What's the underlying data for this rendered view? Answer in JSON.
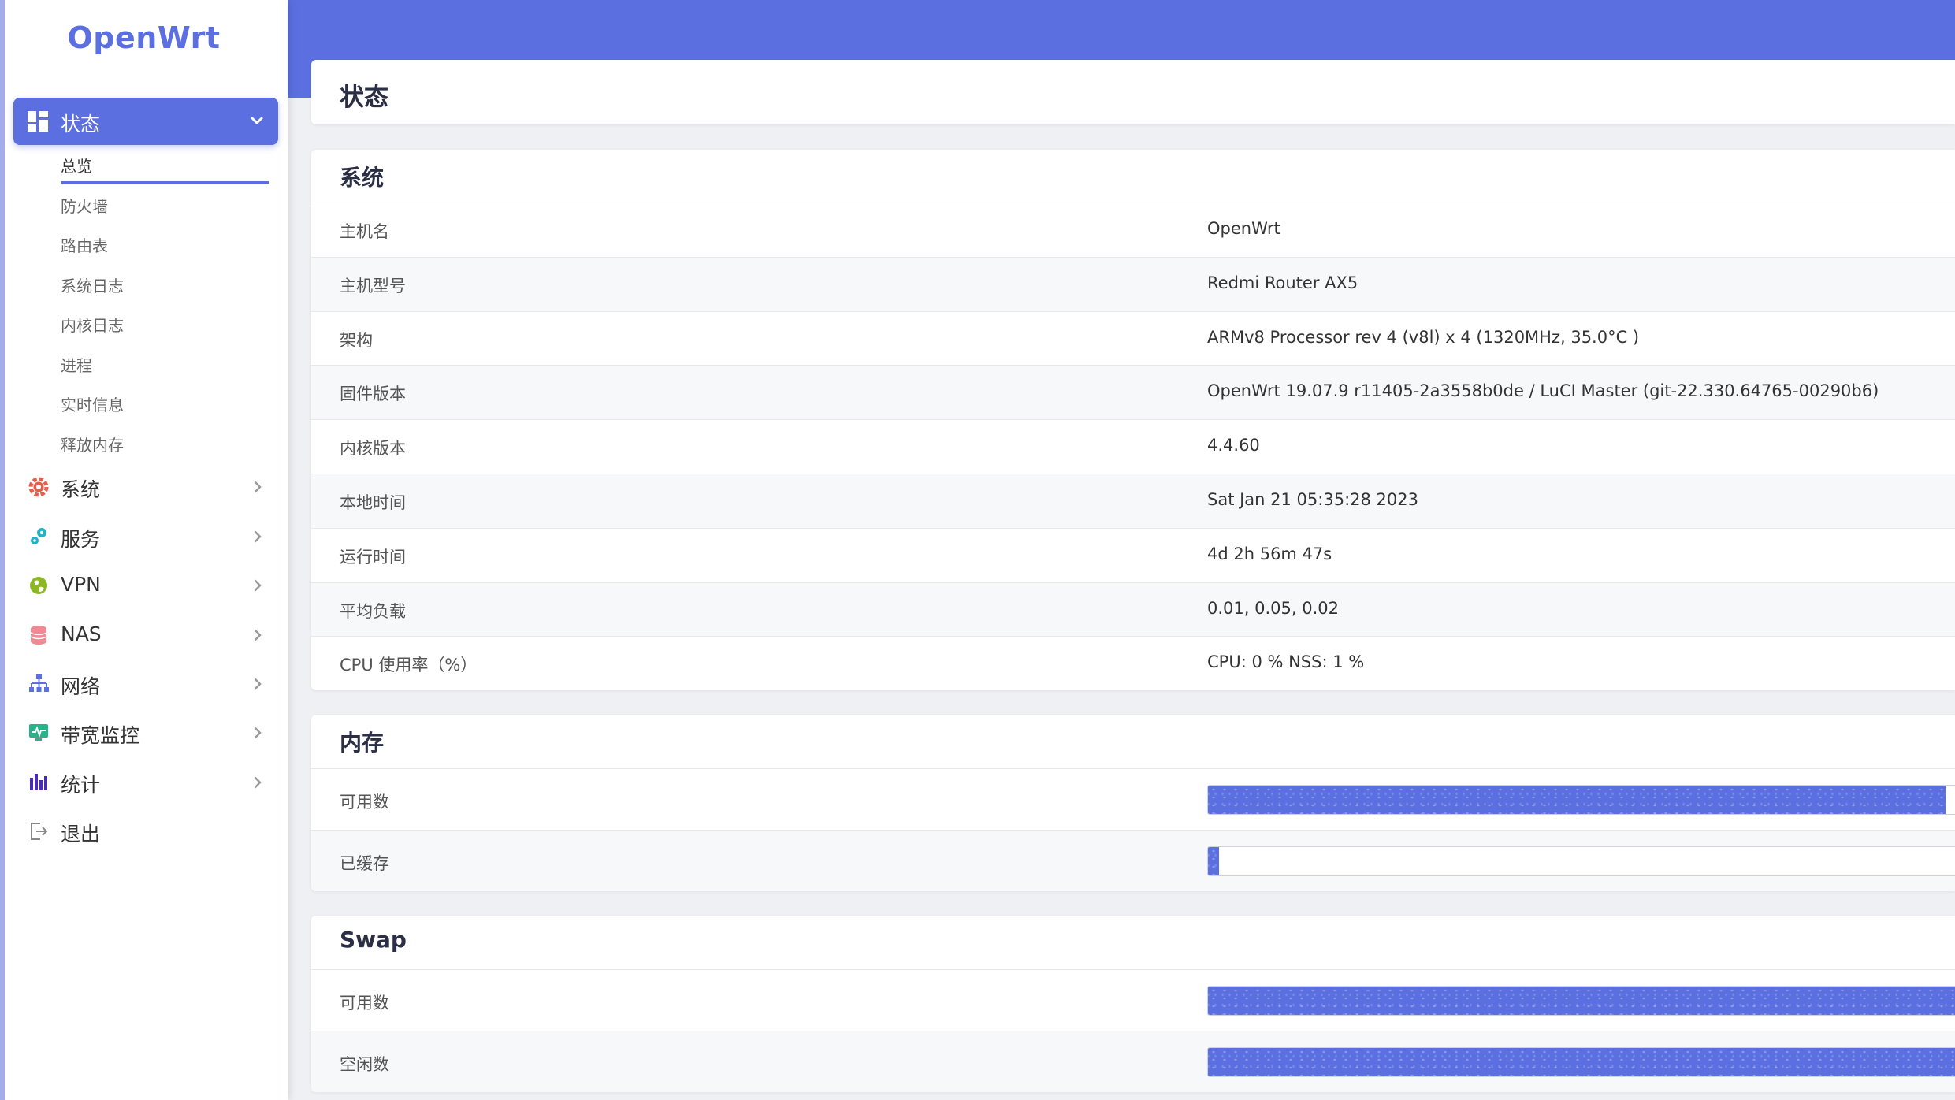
{
  "app": {
    "logo": "OpenWrt"
  },
  "sidebar": {
    "active": {
      "label": "状态"
    },
    "subitems": [
      "总览",
      "防火墙",
      "路由表",
      "系统日志",
      "内核日志",
      "进程",
      "实时信息",
      "释放内存"
    ],
    "items": [
      {
        "label": "系统",
        "icon": "gear-icon"
      },
      {
        "label": "服务",
        "icon": "services-icon"
      },
      {
        "label": "VPN",
        "icon": "globe-icon"
      },
      {
        "label": "NAS",
        "icon": "database-icon"
      },
      {
        "label": "网络",
        "icon": "network-icon"
      },
      {
        "label": "带宽监控",
        "icon": "monitor-icon"
      },
      {
        "label": "统计",
        "icon": "bar-chart-icon"
      },
      {
        "label": "退出",
        "icon": "logout-icon"
      }
    ]
  },
  "page": {
    "title": "状态"
  },
  "system": {
    "title": "系统",
    "rows": [
      {
        "key": "主机名",
        "value": "OpenWrt"
      },
      {
        "key": "主机型号",
        "value": "Redmi Router AX5"
      },
      {
        "key": "架构",
        "value": "ARMv8 Processor rev 4 (v8l) x 4 (1320MHz, 35.0°C )"
      },
      {
        "key": "固件版本",
        "value": "OpenWrt 19.07.9 r11405-2a3558b0de / LuCI Master (git-22.330.64765-00290b6)"
      },
      {
        "key": "内核版本",
        "value": "4.4.60"
      },
      {
        "key": "本地时间",
        "value": "Sat Jan 21 05:35:28 2023"
      },
      {
        "key": "运行时间",
        "value": "4d 2h 56m 47s"
      },
      {
        "key": "平均负载",
        "value": "0.01, 0.05, 0.02"
      },
      {
        "key": "CPU 使用率（%）",
        "value": "CPU: 0 % NSS: 1 %"
      }
    ]
  },
  "memory": {
    "title": "内存",
    "rows": [
      {
        "key": "可用数",
        "fill_percent": 97.5
      },
      {
        "key": "已缓存",
        "fill_percent": 1.5
      }
    ]
  },
  "swap": {
    "title": "Swap",
    "rows": [
      {
        "key": "可用数",
        "fill_percent": 100
      },
      {
        "key": "空闲数",
        "fill_percent": 100
      }
    ]
  },
  "colors": {
    "accent": "#5b6fe0",
    "background": "#eef0f4"
  }
}
